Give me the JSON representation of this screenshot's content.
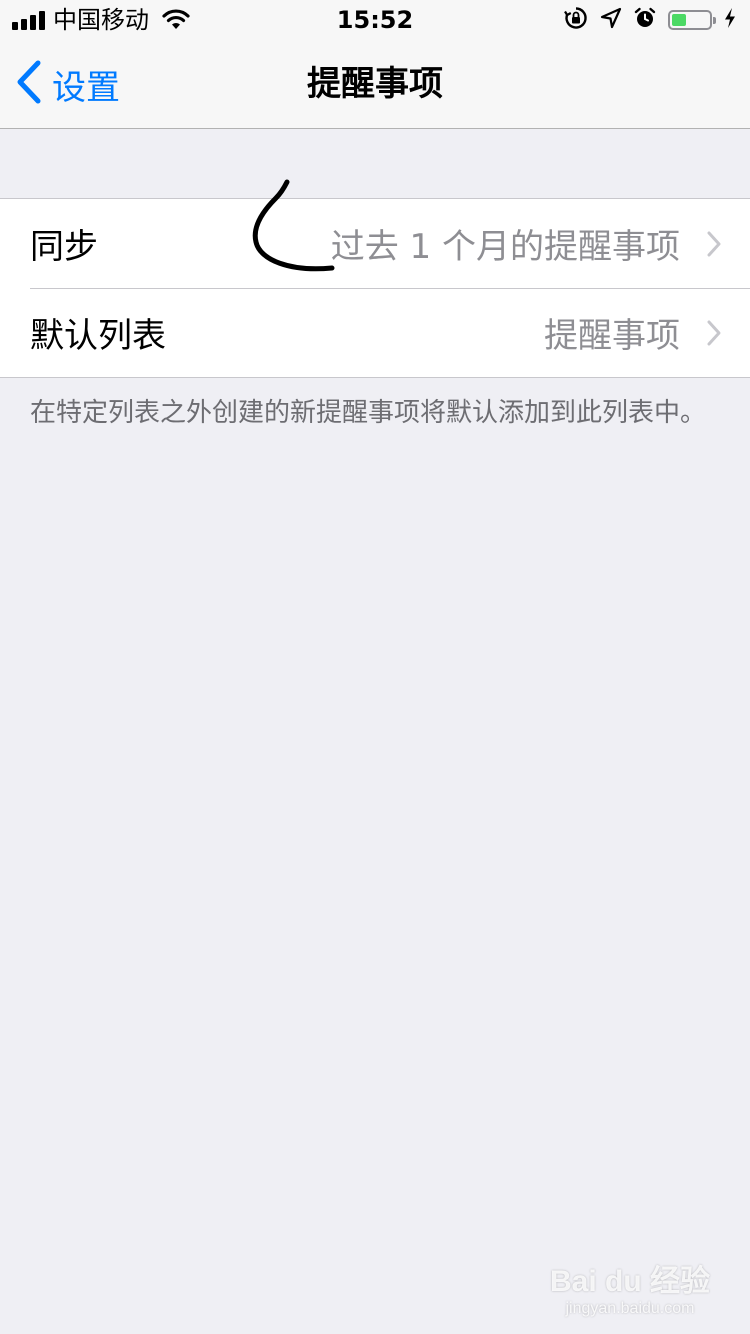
{
  "status_bar": {
    "carrier": "中国移动",
    "time": "15:52",
    "battery_level": 0.36,
    "battery_color": "#4cd964",
    "icons": [
      "signal-bars-icon",
      "wifi-icon",
      "orientation-lock-icon",
      "location-arrow-icon",
      "alarm-clock-icon",
      "battery-icon",
      "charging-bolt-icon"
    ]
  },
  "nav": {
    "back_label": "设置",
    "title": "提醒事项",
    "accent_color": "#007aff"
  },
  "settings": {
    "rows": [
      {
        "label": "同步",
        "value": "过去 1 个月的提醒事项"
      },
      {
        "label": "默认列表",
        "value": "提醒事项"
      }
    ],
    "footer": "在特定列表之外创建的新提醒事项将默认添加到此列表中。"
  },
  "watermark": {
    "logo": "Bai du 经验",
    "sub": "jingyan.baidu.com"
  }
}
